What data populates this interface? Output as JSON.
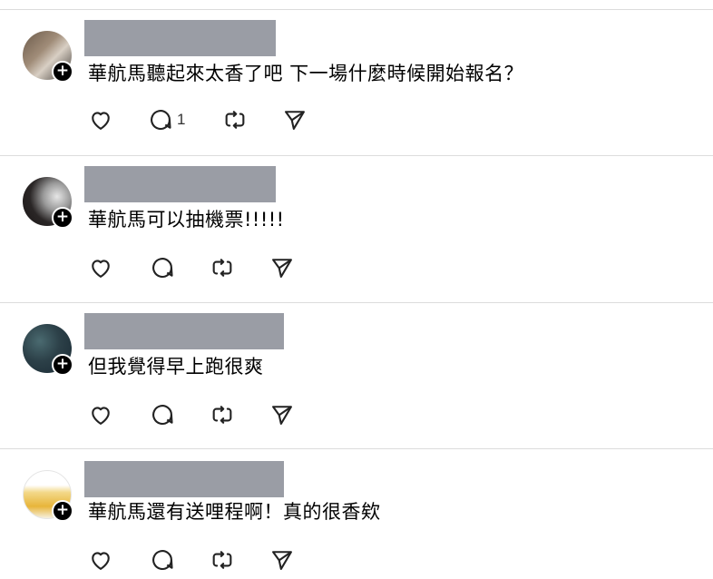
{
  "posts": [
    {
      "text": "華航馬聽起來太香了吧 下一場什麼時候開始報名？",
      "reply_count": "1",
      "follow_badge": "+"
    },
    {
      "text": "華航馬可以抽機票!!!!!",
      "reply_count": "",
      "follow_badge": "+"
    },
    {
      "text": "但我覺得早上跑很爽",
      "reply_count": "",
      "follow_badge": "+"
    },
    {
      "text": "華航馬還有送哩程啊！真的很香欸",
      "reply_count": "",
      "follow_badge": "+"
    }
  ],
  "icons": [
    "heart-icon",
    "comment-icon",
    "repost-icon",
    "share-icon"
  ],
  "colors": {
    "redaction": "#9a9da5",
    "divider": "#dcdcdc",
    "icon": "#222222"
  }
}
